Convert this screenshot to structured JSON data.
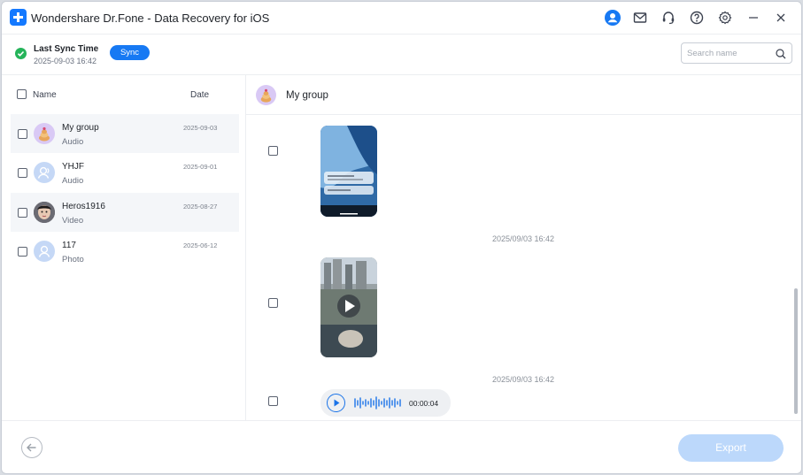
{
  "app": {
    "title": "Wondershare Dr.Fone - Data Recovery for iOS"
  },
  "sync": {
    "label": "Last Sync Time",
    "time": "2025-09-03 16:42",
    "button": "Sync"
  },
  "search": {
    "placeholder": "Search name",
    "value": ""
  },
  "list": {
    "header_name": "Name",
    "header_date": "Date",
    "contacts": [
      {
        "name": "My group",
        "type": "Audio",
        "date": "2025-09-03",
        "avatar": "group-avatar"
      },
      {
        "name": "YHJF",
        "type": "Audio",
        "date": "2025-09-01",
        "avatar": "user-avatar"
      },
      {
        "name": "Heros1916",
        "type": "Video",
        "date": "2025-08-27",
        "avatar": "photo-avatar"
      },
      {
        "name": "117",
        "type": "Photo",
        "date": "2025-06-12",
        "avatar": "user-avatar"
      }
    ]
  },
  "chat": {
    "title": "My group",
    "timestamps": [
      "2025/09/03 16:42",
      "2025/09/03 16:42"
    ],
    "voice_duration": "00:00:04"
  },
  "footer": {
    "export": "Export"
  },
  "colors": {
    "accent": "#1779f3",
    "success": "#25b45a",
    "export_disabled": "#bcd8fb"
  }
}
